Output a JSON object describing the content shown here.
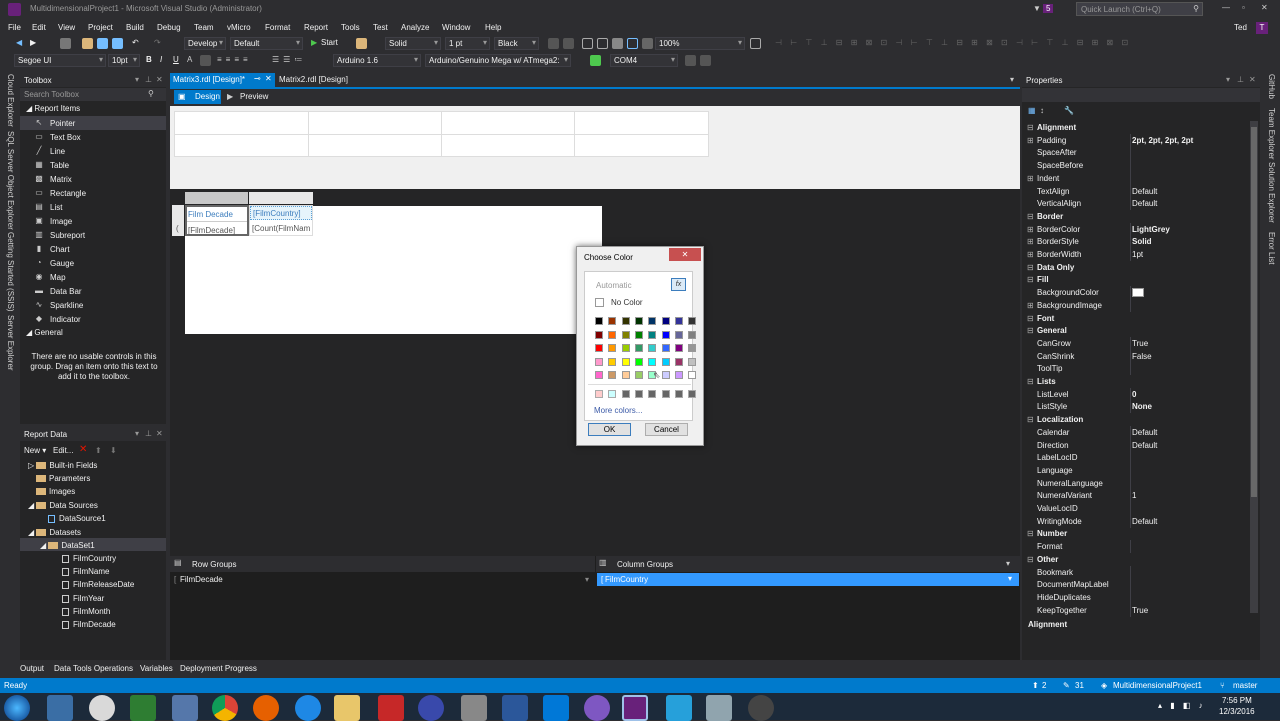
{
  "window": {
    "title": "MultidimensionalProject1 - Microsoft Visual Studio (Administrator)",
    "quick_launch": "Quick Launch (Ctrl+Q)",
    "user": "Ted",
    "notif": "5"
  },
  "menu": [
    "File",
    "Edit",
    "View",
    "Project",
    "Build",
    "Debug",
    "Team",
    "vMicro",
    "Format",
    "Report",
    "Tools",
    "Test",
    "Analyze",
    "Window",
    "Help"
  ],
  "toolbar1": {
    "config": "Develop",
    "platform": "Default",
    "start": "Start",
    "line_style": "Solid",
    "line_width": "1 pt",
    "line_color": "Black",
    "zoom": "100%"
  },
  "toolbar2": {
    "font": "Segoe UI",
    "size": "10pt",
    "bold": "B",
    "italic": "I",
    "underline": "U",
    "board": "Arduino 1.6",
    "device": "Arduino/Genuino Mega w/ ATmega2:",
    "port": "COM4"
  },
  "left_vtabs": [
    "Cloud Explorer",
    "SQL Server Object Explorer",
    "Getting Started (SSIS)",
    "Server Explorer"
  ],
  "right_vtabs": [
    "GitHub",
    "Team Explorer",
    "Solution Explorer",
    "Error List"
  ],
  "toolbox": {
    "title": "Toolbox",
    "search": "Search Toolbox",
    "section": "Report Items",
    "items": [
      "Pointer",
      "Text Box",
      "Line",
      "Table",
      "Matrix",
      "Rectangle",
      "List",
      "Image",
      "Subreport",
      "Chart",
      "Gauge",
      "Map",
      "Data Bar",
      "Sparkline",
      "Indicator"
    ],
    "general": "General",
    "empty": "There are no usable controls in this group. Drag an item onto this text to add it to the toolbox."
  },
  "report_data": {
    "title": "Report Data",
    "new": "New",
    "edit": "Edit...",
    "items": [
      "Built-in Fields",
      "Parameters",
      "Images",
      "Data Sources",
      "DataSource1",
      "Datasets",
      "DataSet1",
      "FilmCountry",
      "FilmName",
      "FilmReleaseDate",
      "FilmYear",
      "FilmMonth",
      "FilmDecade"
    ]
  },
  "tabs": [
    {
      "label": "Matrix3.rdl [Design]*",
      "close": "⊗"
    },
    {
      "label": "Matrix2.rdl [Design]"
    }
  ],
  "design_tabs": {
    "design": "Design",
    "preview": "Preview"
  },
  "matrix": {
    "header": "Film Decade",
    "col": "[FilmCountry]",
    "row": "[FilmDecade]",
    "data": "[Count(FilmNam"
  },
  "dialog": {
    "title": "Choose Color",
    "automatic": "Automatic",
    "fx": "fx",
    "no_color": "No Color",
    "more": "More colors...",
    "ok": "OK",
    "cancel": "Cancel",
    "close": "✕",
    "grid": [
      [
        "#000000",
        "#993300",
        "#333300",
        "#003300",
        "#003366",
        "#000080",
        "#333399",
        "#333333"
      ],
      [
        "#800000",
        "#ff6600",
        "#808000",
        "#008000",
        "#008080",
        "#0000ff",
        "#666699",
        "#808080"
      ],
      [
        "#ff0000",
        "#ff9900",
        "#99cc00",
        "#339966",
        "#33cccc",
        "#3366ff",
        "#800080",
        "#969696"
      ],
      [
        "#ff99cc",
        "#ffcc00",
        "#ffff00",
        "#00ff00",
        "#00ffff",
        "#00ccff",
        "#993366",
        "#c0c0c0"
      ],
      [
        "#ff66cc",
        "#cc9966",
        "#ffcc99",
        "#99cc66",
        "#99ffcc",
        "#ccccff",
        "#cc99ff",
        "#ffffff"
      ]
    ],
    "recent": [
      "#ffcccc",
      "#ccffff",
      "#666666",
      "#666666",
      "#666666",
      "#666666",
      "#666666",
      "#666666"
    ]
  },
  "groups": {
    "row_title": "Row Groups",
    "row_item": "FilmDecade",
    "col_title": "Column Groups",
    "col_item": "FilmCountry"
  },
  "properties": {
    "title": "Properties",
    "rows": [
      {
        "cat": true,
        "k": "Alignment"
      },
      {
        "k": "Padding",
        "v": "2pt, 2pt, 2pt, 2pt",
        "ex": true,
        "b": true
      },
      {
        "k": "SpaceAfter",
        "v": ""
      },
      {
        "k": "SpaceBefore",
        "v": ""
      },
      {
        "k": "Indent",
        "v": "",
        "ex": true
      },
      {
        "k": "TextAlign",
        "v": "Default"
      },
      {
        "k": "VerticalAlign",
        "v": "Default"
      },
      {
        "cat": true,
        "k": "Border"
      },
      {
        "k": "BorderColor",
        "v": "LightGrey",
        "ex": true,
        "b": true
      },
      {
        "k": "BorderStyle",
        "v": "Solid",
        "ex": true,
        "b": true
      },
      {
        "k": "BorderWidth",
        "v": "1pt",
        "ex": true
      },
      {
        "cat": true,
        "k": "Data Only"
      },
      {
        "cat": true,
        "k": "Fill"
      },
      {
        "k": "BackgroundColor",
        "v": "",
        "sw": true
      },
      {
        "k": "BackgroundImage",
        "v": "",
        "ex": true
      },
      {
        "cat": true,
        "k": "Font"
      },
      {
        "cat": true,
        "k": "General"
      },
      {
        "k": "CanGrow",
        "v": "True"
      },
      {
        "k": "CanShrink",
        "v": "False"
      },
      {
        "k": "ToolTip",
        "v": ""
      },
      {
        "cat": true,
        "k": "Lists"
      },
      {
        "k": "ListLevel",
        "v": "0",
        "b": true
      },
      {
        "k": "ListStyle",
        "v": "None",
        "b": true
      },
      {
        "cat": true,
        "k": "Localization"
      },
      {
        "k": "Calendar",
        "v": "Default"
      },
      {
        "k": "Direction",
        "v": "Default"
      },
      {
        "k": "LabelLocID",
        "v": ""
      },
      {
        "k": "Language",
        "v": ""
      },
      {
        "k": "NumeralLanguage",
        "v": ""
      },
      {
        "k": "NumeralVariant",
        "v": "1"
      },
      {
        "k": "ValueLocID",
        "v": ""
      },
      {
        "k": "WritingMode",
        "v": "Default"
      },
      {
        "cat": true,
        "k": "Number"
      },
      {
        "k": "Format",
        "v": ""
      },
      {
        "cat": true,
        "k": "Other"
      },
      {
        "k": "Bookmark",
        "v": ""
      },
      {
        "k": "DocumentMapLabel",
        "v": ""
      },
      {
        "k": "HideDuplicates",
        "v": ""
      },
      {
        "k": "KeepTogether",
        "v": "True"
      }
    ],
    "desc": "Alignment"
  },
  "bottom_tabs": [
    "Output",
    "Data Tools Operations",
    "Variables",
    "Deployment Progress"
  ],
  "status": {
    "ready": "Ready",
    "up": "2",
    "pencil": "31",
    "project": "MultidimensionalProject1",
    "branch": "master"
  },
  "clock": {
    "time": "7:56 PM",
    "date": "12/3/2016"
  }
}
